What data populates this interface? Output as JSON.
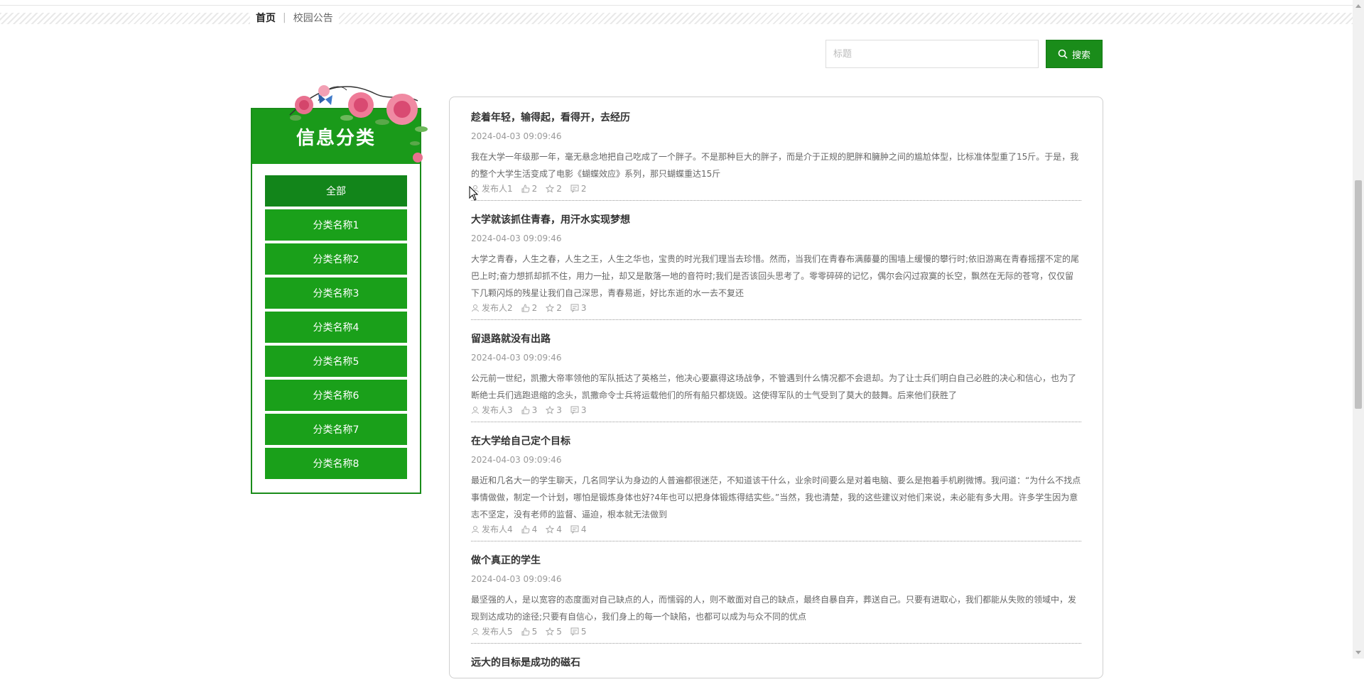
{
  "breadcrumb": {
    "home": "首页",
    "separator": "|",
    "current": "校园公告"
  },
  "search": {
    "placeholder": "标题",
    "button_label": "搜索"
  },
  "category": {
    "title": "信息分类",
    "items": [
      {
        "label": "全部",
        "active": true
      },
      {
        "label": "分类名称1"
      },
      {
        "label": "分类名称2"
      },
      {
        "label": "分类名称3"
      },
      {
        "label": "分类名称4"
      },
      {
        "label": "分类名称5"
      },
      {
        "label": "分类名称6"
      },
      {
        "label": "分类名称7"
      },
      {
        "label": "分类名称8"
      }
    ]
  },
  "posts": [
    {
      "title": "趁着年轻，输得起，看得开，去经历",
      "date": "2024-04-03 09:09:46",
      "body": "我在大学一年级那一年，毫无悬念地把自己吃成了一个胖子。不是那种巨大的胖子，而是介于正规的肥胖和臃肿之间的尴尬体型，比标准体型重了15斤。于是，我的整个大学生活变成了电影《蝴蝶效应》系列，那只蝴蝶重达15斤",
      "author": "发布人1",
      "likes": "2",
      "favorites": "2",
      "comments": "2"
    },
    {
      "title": "大学就该抓住青春，用汗水实现梦想",
      "date": "2024-04-03 09:09:46",
      "body": "大学之青春，人生之春，人生之王，人生之华也，宝贵的时光我们理当去珍惜。然而，当我们在青春布满藤蔓的围墙上缓慢的攀行时;依旧游离在青春摇摆不定的尾巴上时;奋力想抓却抓不住，用力一扯，却又是散落一地的音符时;我们是否该回头思考了。零零碎碎的记忆，偶尔会闪过寂寞的长空，飘然在无际的苍穹，仅仅留下几颗闪烁的残星让我们自己深思，青春易逝，好比东逝的水一去不复还",
      "author": "发布人2",
      "likes": "2",
      "favorites": "2",
      "comments": "3"
    },
    {
      "title": "留退路就没有出路",
      "date": "2024-04-03 09:09:46",
      "body": "公元前一世纪，凯撒大帝率领他的军队抵达了英格兰，他决心要赢得这场战争，不管遇到什么情况都不会退却。为了让士兵们明白自己必胜的决心和信心，也为了断绝士兵们逃跑退缩的念头，凯撒命令士兵将运载他们的所有船只都烧毁。这使得军队的士气受到了莫大的鼓舞。后来他们获胜了",
      "author": "发布人3",
      "likes": "3",
      "favorites": "3",
      "comments": "3"
    },
    {
      "title": "在大学给自己定个目标",
      "date": "2024-04-03 09:09:46",
      "body": "最近和几名大一的学生聊天，几名同学认为身边的人普遍都很迷茫，不知道该干什么，业余时间要么是对着电脑、要么是抱着手机刷微博。我问道：“为什么不找点事情做做，制定一个计划，哪怕是锻炼身体也好?4年也可以把身体锻炼得结实些。”当然，我也清楚，我的这些建议对他们来说，未必能有多大用。许多学生因为意志不坚定，没有老师的监督、逼迫，根本就无法做到",
      "author": "发布人4",
      "likes": "4",
      "favorites": "4",
      "comments": "4"
    },
    {
      "title": "做个真正的学生",
      "date": "2024-04-03 09:09:46",
      "body": "最坚强的人，是以宽容的态度面对自己缺点的人，而懦弱的人，则不敢面对自己的缺点，最终自暴自弃，葬送自己。只要有进取心，我们都能从失败的领域中，发现到达成功的途径;只要有自信心，我们身上的每一个缺陷，也都可以成为与众不同的优点",
      "author": "发布人5",
      "likes": "5",
      "favorites": "5",
      "comments": "5"
    },
    {
      "title": "远大的目标是成功的磁石",
      "date": "",
      "body": "",
      "author": "",
      "likes": "",
      "favorites": "",
      "comments": ""
    }
  ],
  "colors": {
    "accent": "#1a9a1a",
    "accent_dark": "#12851a",
    "text": "#333333",
    "muted": "#999999"
  }
}
